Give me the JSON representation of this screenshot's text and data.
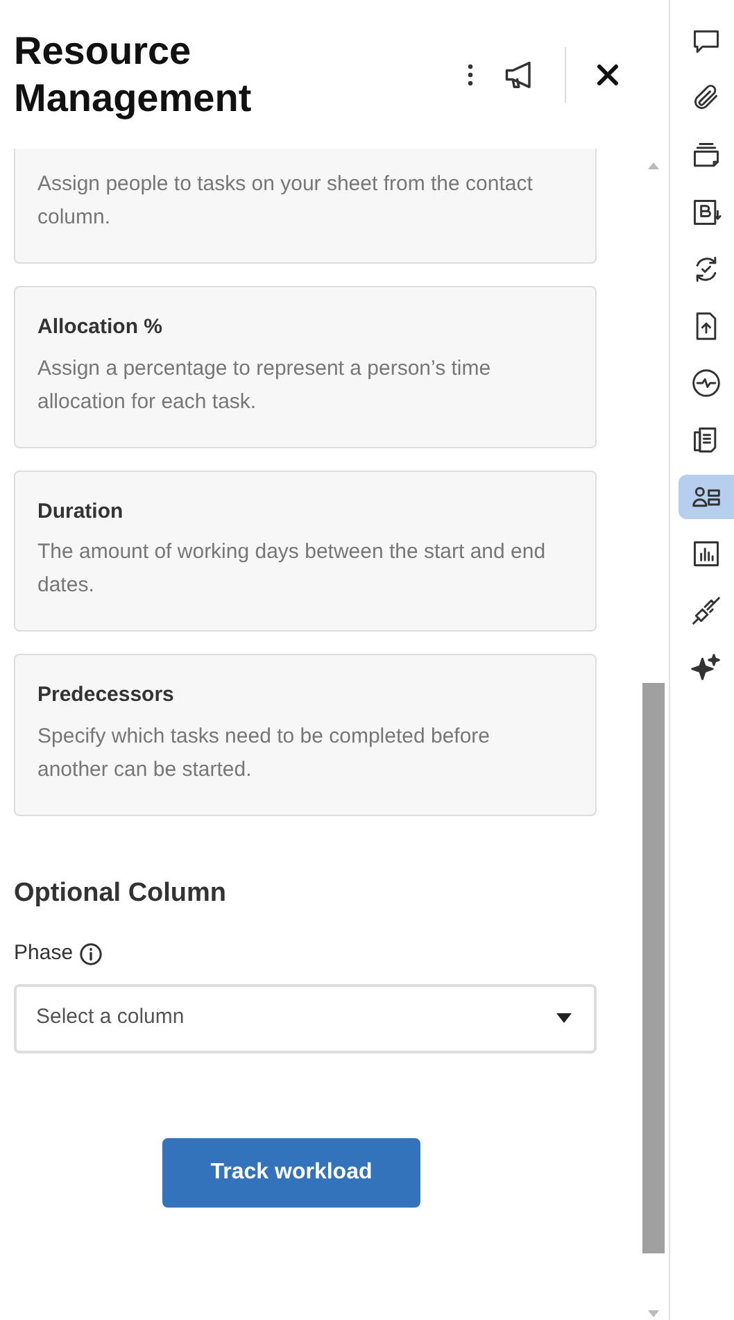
{
  "header": {
    "title": "Resource Management"
  },
  "cards": [
    {
      "description": "Assign people to tasks on your sheet from the contact column."
    },
    {
      "title": "Allocation %",
      "description": "Assign a percentage to represent a person’s time allocation for each task."
    },
    {
      "title": "Duration",
      "description": "The amount of working days between the start and end dates."
    },
    {
      "title": "Predecessors",
      "description": "Specify which tasks need to be completed before another can be started."
    }
  ],
  "optional": {
    "heading": "Optional Column",
    "field_label": "Phase",
    "select": {
      "placeholder": "Select a column"
    }
  },
  "button": "Track workload",
  "sidebar": {
    "items": [
      {
        "selected": false
      },
      {
        "selected": false
      },
      {
        "selected": false
      },
      {
        "selected": false
      },
      {
        "selected": false
      },
      {
        "selected": false
      },
      {
        "selected": false
      },
      {
        "selected": false
      },
      {
        "selected": true
      },
      {
        "selected": false
      },
      {
        "selected": false
      },
      {
        "selected": false
      }
    ]
  }
}
